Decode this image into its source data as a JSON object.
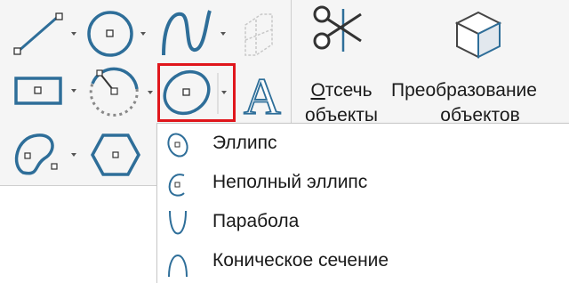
{
  "ribbon": {
    "cut_objects": {
      "line1_hot": "О",
      "line1_rest": "тсечь",
      "line2": "объекты"
    },
    "transform_objects": {
      "line1": "Преобразование",
      "line2": "объектов"
    },
    "accent_color": "#2e6e99",
    "highlight_color": "#e0161c"
  },
  "menu": {
    "items": [
      {
        "label": "Эллипс",
        "icon": "ellipse-icon"
      },
      {
        "label": "Неполный эллипс",
        "icon": "partial-ellipse-icon"
      },
      {
        "label": "Парабола",
        "icon": "parabola-icon"
      },
      {
        "label": "Коническое сечение",
        "icon": "conic-section-icon"
      }
    ]
  }
}
